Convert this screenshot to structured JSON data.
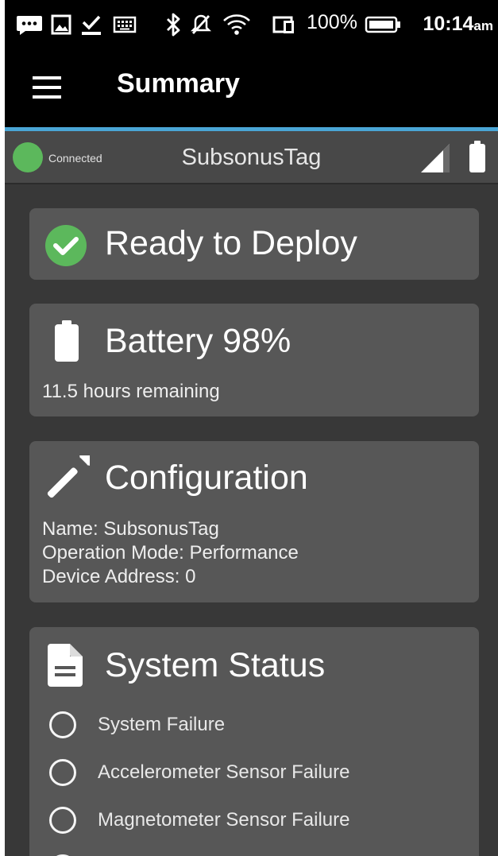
{
  "statusbar": {
    "icons": [
      "message-icon",
      "image-icon",
      "download-done-icon",
      "keyboard-icon",
      "bluetooth-icon",
      "mute-icon",
      "wifi-icon",
      "portrait-icon"
    ],
    "battery_percent": "100%",
    "time": "10:14",
    "time_suffix": "am"
  },
  "appbar": {
    "menu_icon": "menu-icon",
    "title": "Summary"
  },
  "connection": {
    "status_label": "Connected",
    "status_color": "#5cb85c",
    "device_name": "SubsonusTag",
    "signal_icon": "signal-icon",
    "battery_icon": "battery-icon"
  },
  "cards": {
    "deploy": {
      "icon": "check-circle-icon",
      "title": "Ready to Deploy"
    },
    "battery": {
      "icon": "battery-full-icon",
      "title": "Battery 98%",
      "remaining": "11.5 hours remaining"
    },
    "configuration": {
      "icon": "wrench-icon",
      "title": "Configuration",
      "lines": [
        "Name: SubsonusTag",
        "Operation Mode: Performance",
        "Device Address: 0"
      ]
    },
    "system_status": {
      "icon": "document-icon",
      "title": "System Status",
      "items": [
        "System Failure",
        "Accelerometer Sensor Failure",
        "Magnetometer Sensor Failure"
      ]
    }
  },
  "colors": {
    "accent": "#4aa6d6",
    "ok": "#5cb85c",
    "card_bg": "#575757",
    "page_bg": "#383838"
  }
}
